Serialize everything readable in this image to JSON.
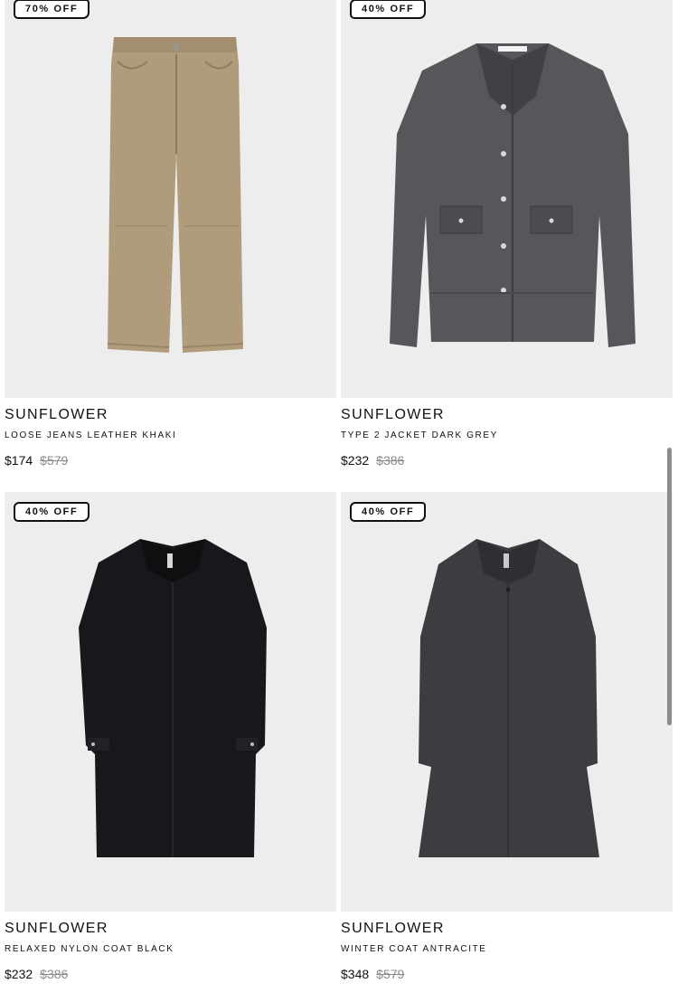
{
  "products": [
    {
      "badge": "70% OFF",
      "brand": "SUNFLOWER",
      "name": "LOOSE JEANS LEATHER KHAKI",
      "price": "$174",
      "original_price": "$579",
      "image_icon": "khaki-leather-pants"
    },
    {
      "badge": "40% OFF",
      "brand": "SUNFLOWER",
      "name": "TYPE 2 JACKET DARK GREY",
      "price": "$232",
      "original_price": "$386",
      "image_icon": "dark-grey-denim-jacket"
    },
    {
      "badge": "40% OFF",
      "brand": "SUNFLOWER",
      "name": "RELAXED NYLON COAT BLACK",
      "price": "$232",
      "original_price": "$386",
      "image_icon": "black-nylon-coat"
    },
    {
      "badge": "40% OFF",
      "brand": "SUNFLOWER",
      "name": "WINTER COAT ANTRACITE",
      "price": "$348",
      "original_price": "$579",
      "image_icon": "anthracite-wool-coat"
    }
  ],
  "colors": {
    "image_background": "#ededed",
    "khaki": "#b09c7a",
    "denim_grey": "#55575b",
    "nylon_black": "#16181b",
    "wool_anthracite": "#3c3d40",
    "strike_price": "#8a8a8a"
  }
}
